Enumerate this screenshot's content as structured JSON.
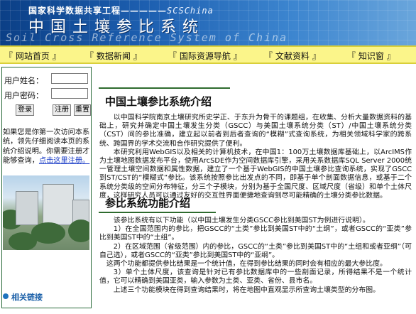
{
  "banner": {
    "project": "国家科学数据共享工程",
    "sep": "—————",
    "abbr": "SCSChina",
    "title": "中国土壤参比系统",
    "subtitle": "Soil Cross Reference System of China"
  },
  "nav": {
    "items": [
      {
        "label": "『 网站首页 』"
      },
      {
        "label": "『 数据新闻 』"
      },
      {
        "label": "『 国际资源导航 』"
      },
      {
        "label": "『 文献资料 』"
      },
      {
        "label": "『 知识窗 』"
      }
    ]
  },
  "login": {
    "username_label": "用户姓名：",
    "password_label": "用户密码：",
    "username_value": "",
    "password_value": "",
    "login_button": "登录",
    "register_button": "注册",
    "reset_button": "重置"
  },
  "sidebar": {
    "note_text": "如果您是你第一次访问本系统，领先仔细阅读本页的系统介绍说明。你需要注册才能够查询，",
    "note_link": "点击这里注册。",
    "related_links": "相关链接"
  },
  "main": {
    "intro_title": "中国土壤参比系统介绍",
    "intro_p1": "以中国科学院南京土壤研究所史学正、于东升为骨干的课题组，在收集、分析大量数据资料的基础上，研究并确定中国土壤发生分类（GSCC）与美国土壤系统分类（ST）/中国土壤系统分类（CST）间的参比准确，建立起以前者到后者查询的“模糊”式查询系统，为相关领域科学家的跨系统、跨国界的学术交流和合作研究提供了便利。",
    "intro_p2": "本研究利用WebGIS以及相关的计算机技术，在中国1：100万土壤数据库基础上，以ArcIMS作为土壤地图数据发布平台，使用ArcSDE作为空间数据库引擎，采用关系数据库SQL Server 2000统一管理土壤空间数据和属性数据，建立了一个基于WebGIS的中国土壤参比查询系统，实现了GSCC到ST/CST的“模糊式”参比。该系统按照参比出发点的不同，即基于单个剖面数据信息，或基于二个系统分类级的空间分布特征，分三个子模块，分别为基于全国尺度、区域尺度（省级）和单个土体尺度，这样研究人员可以通过友好的交互性界面便捷地查询到尽可能精确的土壤分类参比数据。",
    "func_title": "参比系统功能介绍",
    "func_lines": [
      "该参比系统有以下功能（以中国土壤发生分类GSCC参比到美国ST为例进行说明）。",
      "1）在全国范围内的参比，把GSCC的“土类”参比到美国ST中的“土纲”，或者GSCC的“亚类”参比到美国ST中的“土组”。",
      "2）在区域范围（省级范围）内的参比，GSCC的“土类”参比到美国ST中的“土组和或者亚纲”（可自己选），或者GSCC的“亚类”参比到美国ST中的“亚纲”。",
      "这两个功能都提供参比结果是一个统计值，在得到参比结果的同时会有相应的最大参比度。",
      "3）单个土体尺度，该查询是针对已有参比数据库中的一些剖面记录，所得结果不是一个统计值，它可以精确到美国亚类，输入参数为土类、亚类、省份、县市名。",
      "上述三个功能模块在得到查询结果时，将在地图中直观显示所查询土壤类型的分布图。"
    ]
  }
}
